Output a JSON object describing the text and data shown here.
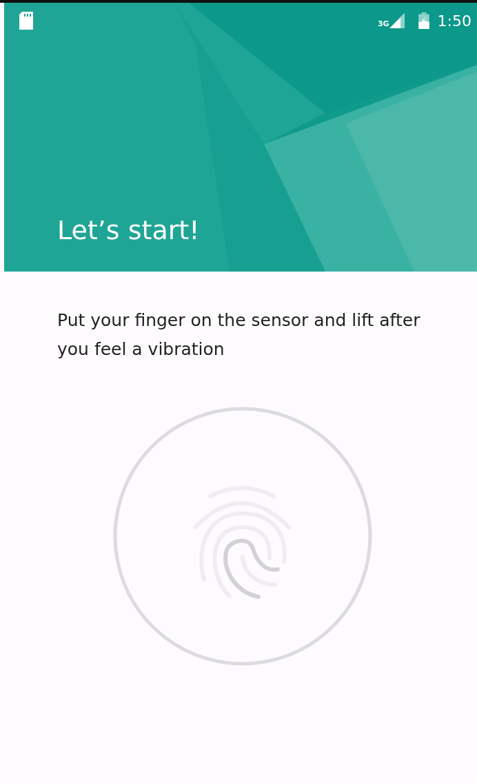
{
  "status_bar": {
    "network": "3G",
    "time": "1:50"
  },
  "header": {
    "title": "Let’s start!"
  },
  "instruction": "Put your finger on the sensor and lift after you feel a vibration"
}
